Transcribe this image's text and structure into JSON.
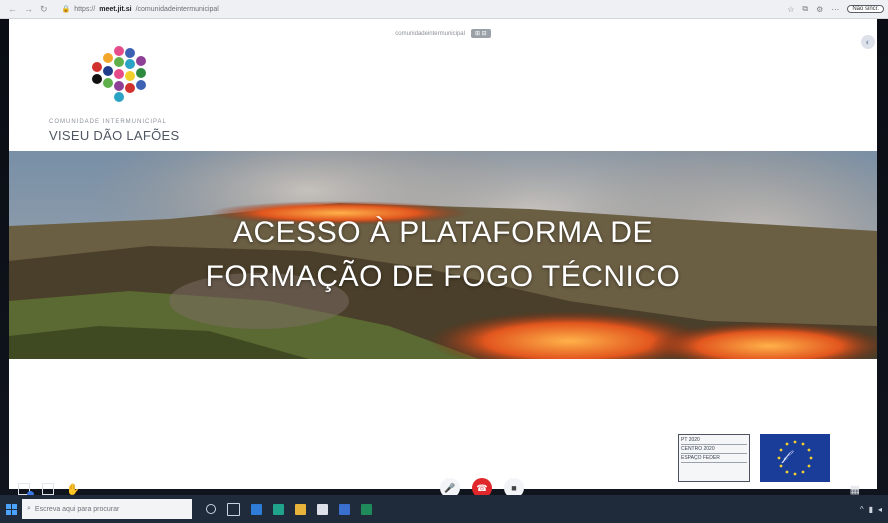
{
  "browser": {
    "url_prefix": "https://",
    "url_host": "meet.jit.si",
    "url_path": "/comunidadeintermunicipal",
    "profile_label": "Não sincr."
  },
  "presenter_bar": {
    "name": "comunidadeintermunicipal",
    "tag": "⊞ ⊟"
  },
  "slide": {
    "org_small": "COMUNIDADE INTERMUNICIPAL",
    "org_big": "VISEU DÃO LAFÕES",
    "title_line1": "ACESSO À PLATAFORMA DE",
    "title_line2": "FORMAÇÃO DE FOGO TÉCNICO",
    "funding_lines": [
      "PT 2020",
      "CENTRO 2020",
      "ESPAÇO FEDER"
    ]
  },
  "taskbar": {
    "search_placeholder": "Escreva aqui para procurar"
  },
  "colors": {
    "hangup": "#e0272b",
    "taskbar": "#1f2a3a",
    "eu_blue": "#1b3d9a"
  }
}
